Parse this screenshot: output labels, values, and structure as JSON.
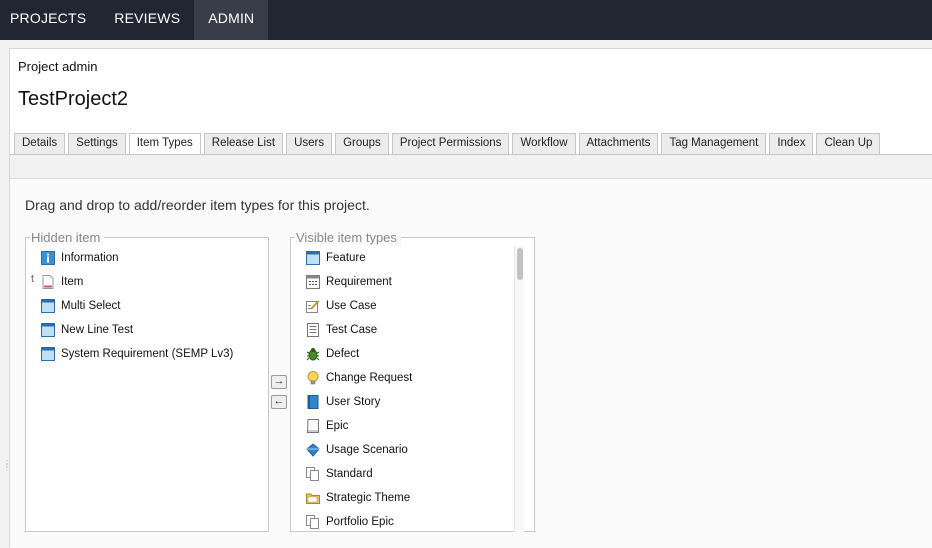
{
  "topnav": {
    "items": [
      {
        "label": "PROJECTS"
      },
      {
        "label": "REVIEWS"
      },
      {
        "label": "ADMIN"
      }
    ],
    "active": "ADMIN"
  },
  "breadcrumb": "Project admin",
  "project_title": "TestProject2",
  "tabs": [
    {
      "label": "Details"
    },
    {
      "label": "Settings"
    },
    {
      "label": "Item Types"
    },
    {
      "label": "Release List"
    },
    {
      "label": "Users"
    },
    {
      "label": "Groups"
    },
    {
      "label": "Project Permissions"
    },
    {
      "label": "Workflow"
    },
    {
      "label": "Attachments"
    },
    {
      "label": "Tag Management"
    },
    {
      "label": "Index"
    },
    {
      "label": "Clean Up"
    }
  ],
  "active_tab": "Item Types",
  "instructions": "Drag and drop to add/reorder item types for this project.",
  "hidden_panel": {
    "legend": "Hidden item",
    "stray_char": "t",
    "items": [
      {
        "label": "Information",
        "icon": "information-icon"
      },
      {
        "label": "Item",
        "icon": "document-icon"
      },
      {
        "label": "Multi Select",
        "icon": "window-icon"
      },
      {
        "label": "New Line Test",
        "icon": "window-icon"
      },
      {
        "label": "System Requirement (SEMP Lv3)",
        "icon": "window-icon"
      }
    ]
  },
  "visible_panel": {
    "legend": "Visible item types",
    "items": [
      {
        "label": "Feature",
        "icon": "window-icon"
      },
      {
        "label": "Requirement",
        "icon": "requirement-icon"
      },
      {
        "label": "Use Case",
        "icon": "use-case-icon"
      },
      {
        "label": "Test Case",
        "icon": "test-case-icon"
      },
      {
        "label": "Defect",
        "icon": "bug-icon"
      },
      {
        "label": "Change Request",
        "icon": "lightbulb-icon"
      },
      {
        "label": "User Story",
        "icon": "book-icon"
      },
      {
        "label": "Epic",
        "icon": "epic-icon"
      },
      {
        "label": "Usage Scenario",
        "icon": "diamond-icon"
      },
      {
        "label": "Standard",
        "icon": "copy-icon"
      },
      {
        "label": "Strategic Theme",
        "icon": "folder-icon"
      },
      {
        "label": "Portfolio Epic",
        "icon": "copy-icon"
      }
    ]
  },
  "move_buttons": {
    "right": "→",
    "left": "←"
  }
}
